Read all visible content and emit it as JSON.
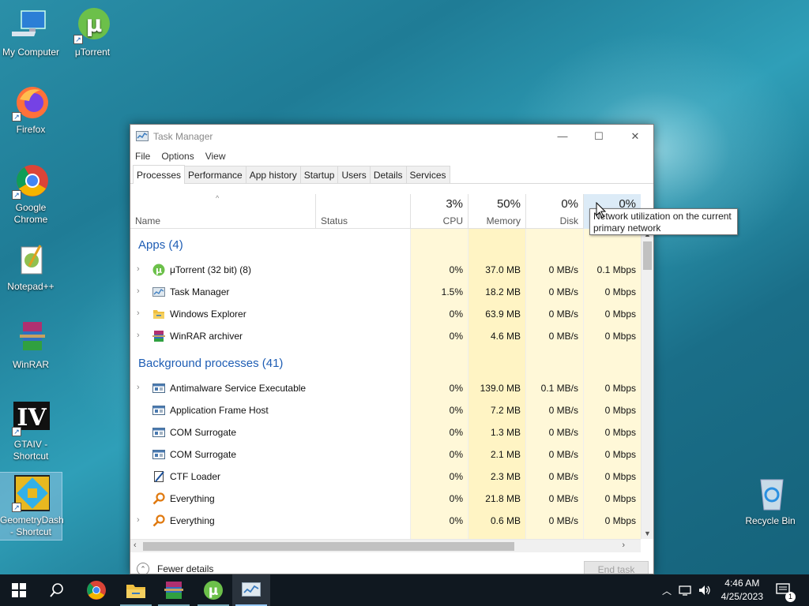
{
  "desktop": {
    "icons": [
      {
        "label": "My Computer",
        "icon": "computer-icon"
      },
      {
        "label": "μTorrent",
        "icon": "utorrent-icon"
      },
      {
        "label": "Firefox",
        "icon": "firefox-icon"
      },
      {
        "label": "Google Chrome",
        "icon": "chrome-icon"
      },
      {
        "label": "Notepad++",
        "icon": "notepadpp-icon"
      },
      {
        "label": "WinRAR",
        "icon": "winrar-icon"
      },
      {
        "label": "GTAIV - Shortcut",
        "icon": "gtaiv-icon"
      },
      {
        "label": "GeometryDash - Shortcut",
        "icon": "geometrydash-icon"
      },
      {
        "label": "Recycle Bin",
        "icon": "recycle-bin-icon"
      }
    ]
  },
  "window": {
    "title": "Task Manager",
    "controls": {
      "minimize": "—",
      "maximize": "☐",
      "close": "✕"
    },
    "menu": [
      "File",
      "Options",
      "View"
    ],
    "tabs": [
      "Processes",
      "Performance",
      "App history",
      "Startup",
      "Users",
      "Details",
      "Services"
    ],
    "active_tab": "Processes",
    "columns": {
      "name": "Name",
      "status": "Status",
      "cpu": {
        "pct": "3%",
        "label": "CPU"
      },
      "memory": {
        "pct": "50%",
        "label": "Memory"
      },
      "disk": {
        "pct": "0%",
        "label": "Disk"
      },
      "network": {
        "pct": "0%",
        "label": ""
      }
    },
    "groups": {
      "apps": "Apps (4)",
      "background": "Background processes (41)"
    },
    "apps": [
      {
        "name": "μTorrent (32 bit) (8)",
        "icon": "utorrent-icon",
        "expandable": true,
        "cpu": "0%",
        "memory": "37.0 MB",
        "disk": "0 MB/s",
        "network": "0.1 Mbps"
      },
      {
        "name": "Task Manager",
        "icon": "task-manager-icon",
        "expandable": true,
        "cpu": "1.5%",
        "memory": "18.2 MB",
        "disk": "0 MB/s",
        "network": "0 Mbps"
      },
      {
        "name": "Windows Explorer",
        "icon": "folder-icon",
        "expandable": true,
        "cpu": "0%",
        "memory": "63.9 MB",
        "disk": "0 MB/s",
        "network": "0 Mbps"
      },
      {
        "name": "WinRAR archiver",
        "icon": "winrar-icon",
        "expandable": true,
        "cpu": "0%",
        "memory": "4.6 MB",
        "disk": "0 MB/s",
        "network": "0 Mbps"
      }
    ],
    "background": [
      {
        "name": "Antimalware Service Executable",
        "icon": "service-icon",
        "expandable": true,
        "cpu": "0%",
        "memory": "139.0 MB",
        "disk": "0.1 MB/s",
        "network": "0 Mbps"
      },
      {
        "name": "Application Frame Host",
        "icon": "service-icon",
        "expandable": false,
        "cpu": "0%",
        "memory": "7.2 MB",
        "disk": "0 MB/s",
        "network": "0 Mbps"
      },
      {
        "name": "COM Surrogate",
        "icon": "service-icon",
        "expandable": false,
        "cpu": "0%",
        "memory": "1.3 MB",
        "disk": "0 MB/s",
        "network": "0 Mbps"
      },
      {
        "name": "COM Surrogate",
        "icon": "service-icon",
        "expandable": false,
        "cpu": "0%",
        "memory": "2.1 MB",
        "disk": "0 MB/s",
        "network": "0 Mbps"
      },
      {
        "name": "CTF Loader",
        "icon": "ctf-icon",
        "expandable": false,
        "cpu": "0%",
        "memory": "2.3 MB",
        "disk": "0 MB/s",
        "network": "0 Mbps"
      },
      {
        "name": "Everything",
        "icon": "search-magnifier-icon",
        "expandable": false,
        "cpu": "0%",
        "memory": "21.8 MB",
        "disk": "0 MB/s",
        "network": "0 Mbps"
      },
      {
        "name": "Everything",
        "icon": "search-magnifier-icon",
        "expandable": true,
        "cpu": "0%",
        "memory": "0.6 MB",
        "disk": "0 MB/s",
        "network": "0 Mbps"
      }
    ],
    "footer": {
      "fewer_details": "Fewer details",
      "end_task": "End task"
    },
    "tooltip": "Network utilization on the current primary network"
  },
  "taskbar": {
    "items": [
      "start-icon",
      "search-icon",
      "chrome-icon",
      "file-explorer-icon",
      "winrar-icon",
      "utorrent-icon",
      "task-manager-icon"
    ],
    "time": "4:46 AM",
    "date": "4/25/2023",
    "notification_count": "1"
  },
  "colors": {
    "accent": "#1e5db4",
    "heat_light": "#fff4c4",
    "heat_medium": "#f9e79f",
    "taskbar": "#101820"
  }
}
